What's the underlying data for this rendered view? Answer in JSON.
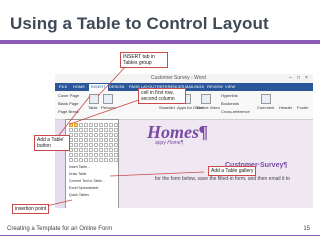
{
  "slide": {
    "title": "Using a Table to Control Layout",
    "footer_left": "Creating a Template for an Online Form",
    "page_number": "15",
    "accent_color": "#8a5cb5"
  },
  "word": {
    "window_title": "Customer Survey - Word",
    "tabs": [
      "FILE",
      "HOME",
      "INSERT",
      "DESIGN",
      "PAGE LAYOUT",
      "REFERENCES",
      "MAILINGS",
      "REVIEW",
      "VIEW"
    ],
    "active_tab": "INSERT",
    "ribbon_items": [
      "Cover Page",
      "Blank Page",
      "Page Break",
      "Table",
      "Pictures",
      "Online Pictures",
      "Shapes",
      "SmartArt",
      "Apps for Office",
      "Online Video",
      "Hyperlink",
      "Bookmark",
      "Cross-reference",
      "Comment",
      "Header",
      "Footer"
    ],
    "table_menu": [
      "Insert Table...",
      "Draw Table",
      "Convert Text to Table...",
      "Excel Spreadsheet",
      "Quick Tables"
    ],
    "doc_heading": "Homes¶",
    "doc_sub": "appy Home¶",
    "doc_survey": "Customer·Survey¶",
    "doc_instruction": "for the form below, save the filled-in form, and then email it to"
  },
  "callouts": {
    "insert_tab": "INSERT tab in Tables group",
    "add_table_button": "Add a Table' button",
    "cell": "cell in first row, second column",
    "add_gallery": "Add a Table gallery",
    "insertion_point": "insertion point"
  }
}
